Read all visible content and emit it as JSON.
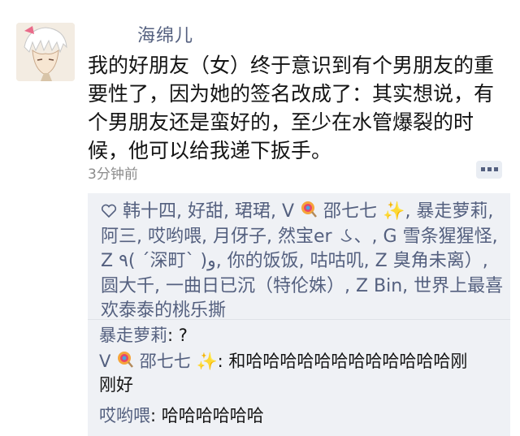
{
  "post": {
    "author": "海绵儿",
    "text": "我的好朋友（女）终于意识到有个男朋友的重要性了，因为她的签名改成了：其实想说，有个男朋友还是蛮好的，至少在水管爆裂的时候，他可以给我递下扳手。",
    "time": "3分钟前"
  },
  "likes": {
    "icon": "heart-outline-icon",
    "part1": "韩十四, 好甜, 珺珺, V",
    "part2": "邵七七",
    "part3": ", 暴走萝莉, 阿三, 哎哟喂, 月伢子, 然宝er",
    "part4": "、, G 雪条猩猩怪, Z ٩( ˊ深町ˋ )و, 你的饭饭, 咕咕叽, Z 臭角未离）, 圆大千, 一曲日已沉（特伦姝）, Z Bin, 世界上最喜欢泰泰的桃乐撕"
  },
  "comments": [
    {
      "user": "暴走萝莉",
      "sep": ": ",
      "text": "?"
    },
    {
      "user_prefix": "V",
      "user": "邵七七",
      "sep": ": ",
      "text": "和哈哈哈哈哈哈哈哈哈哈哈哈刚刚好"
    },
    {
      "user": "哎哟喂",
      "sep": ": ",
      "text": "哈哈哈哈哈哈"
    }
  ],
  "colors": {
    "link": "#54607f",
    "comment_bg": "#eff1f5",
    "time": "#8b8b8b"
  }
}
